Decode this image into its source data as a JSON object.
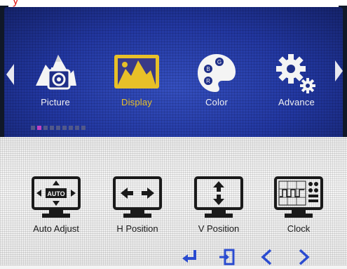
{
  "main_menu": {
    "items": [
      {
        "label": "Picture",
        "icon": "picture-icon"
      },
      {
        "label": "Display",
        "icon": "display-icon"
      },
      {
        "label": "Color",
        "icon": "palette-icon"
      },
      {
        "label": "Advance",
        "icon": "gears-icon"
      }
    ],
    "selected": "Display"
  },
  "sub_menu": {
    "items": [
      {
        "label": "Auto Adjust",
        "icon": "auto-adjust-icon",
        "icon_text": "AUTO"
      },
      {
        "label": "H Position",
        "icon": "h-position-icon"
      },
      {
        "label": "V Position",
        "icon": "v-position-icon"
      },
      {
        "label": "Clock",
        "icon": "clock-icon"
      }
    ]
  },
  "controls": [
    "enter-icon",
    "exit-icon",
    "previous-icon",
    "next-icon"
  ],
  "colors": {
    "osd_blue": "#2237a0",
    "highlight": "#e8c028",
    "control_blue": "#2a4bd0",
    "annotation_red": "#e02020"
  }
}
